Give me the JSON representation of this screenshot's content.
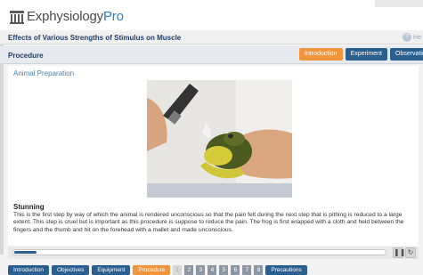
{
  "app": {
    "logo_text": "Exphysiology",
    "logo_suffix": "Pro"
  },
  "experiment": {
    "title": "Effects of Various Strengths of Stimulus on Muscle",
    "help_label": "He"
  },
  "procedure": {
    "label": "Procedure",
    "tabs": [
      {
        "label": "Introduction",
        "active": true
      },
      {
        "label": "Experiment",
        "active": false
      },
      {
        "label": "Observation",
        "active": false
      }
    ]
  },
  "content": {
    "section_title": "Animal Preparation",
    "heading": "Stunning",
    "paragraph": "This is the first step by way of which the animal is rendered unconscious so that the pain felt during the next step that is pithing is reduced to a large extent. This step is cruel but is important as this procedure is suppose to reduce the pain. The frog is first wrapped with a cloth and held between the fingers and the thumb and hit on the forehead with a mallet and made unconscious."
  },
  "player": {
    "progress": 0.06,
    "pause_icon": "pause-icon",
    "replay_icon": "replay-icon"
  },
  "bottom_nav": {
    "tabs": [
      {
        "label": "Introduction",
        "active": false
      },
      {
        "label": "Objectives",
        "active": false
      },
      {
        "label": "Equipment",
        "active": false
      },
      {
        "label": "Procedure",
        "active": true
      }
    ],
    "steps": [
      "1",
      "2",
      "3",
      "4",
      "5",
      "6",
      "7",
      "8"
    ],
    "last_tab": "Precautions"
  },
  "colors": {
    "accent": "#f0953b",
    "nav_blue": "#2a5f8f",
    "title_blue": "#1e3f6b",
    "link_blue": "#4a7fb0"
  }
}
